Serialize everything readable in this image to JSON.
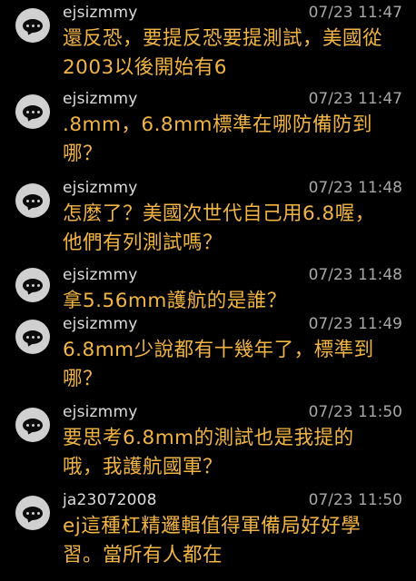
{
  "comments": [
    {
      "username": "ejsizmmy",
      "timestamp": "07/23 11:47",
      "lines": [
        "還反恐，要提反恐要提測試，美國從",
        "2003以後開始有6"
      ],
      "avatar_icon": "chat-bubble-icon"
    },
    {
      "username": "ejsizmmy",
      "timestamp": "07/23 11:47",
      "lines": [
        ".8mm，6.8mm標準在哪防備防到",
        "哪？"
      ],
      "avatar_icon": "chat-bubble-icon"
    },
    {
      "username": "ejsizmmy",
      "timestamp": "07/23 11:48",
      "lines": [
        "怎麼了？美國次世代自己用6.8喔，",
        "他們有列測試嗎？"
      ],
      "avatar_icon": "chat-bubble-icon"
    },
    {
      "username": "ejsizmmy",
      "timestamp": "07/23 11:48",
      "lines": [
        "拿5.56mm護航的是誰？"
      ],
      "avatar_icon": "chat-bubble-icon"
    },
    {
      "username": "ejsizmmy",
      "timestamp": "07/23 11:49",
      "lines": [
        "6.8mm少說都有十幾年了，標準到",
        "哪？"
      ],
      "avatar_icon": "chat-bubble-icon"
    },
    {
      "username": "ejsizmmy",
      "timestamp": "07/23 11:50",
      "lines": [
        "要思考6.8mm的測試也是我提的",
        "哦，我護航國軍？"
      ],
      "avatar_icon": "chat-bubble-icon"
    },
    {
      "username": "ja23072008",
      "timestamp": "07/23 11:50",
      "lines": [
        "ej這種杠精邏輯值得軍備局好好學",
        "習。當所有人都在"
      ],
      "avatar_icon": "chat-bubble-icon"
    }
  ],
  "colors": {
    "background": "#000000",
    "username": "#dcdcdc",
    "timestamp": "#a8a8a8",
    "message": "#f2b544",
    "avatar": "#d0d0d0"
  }
}
